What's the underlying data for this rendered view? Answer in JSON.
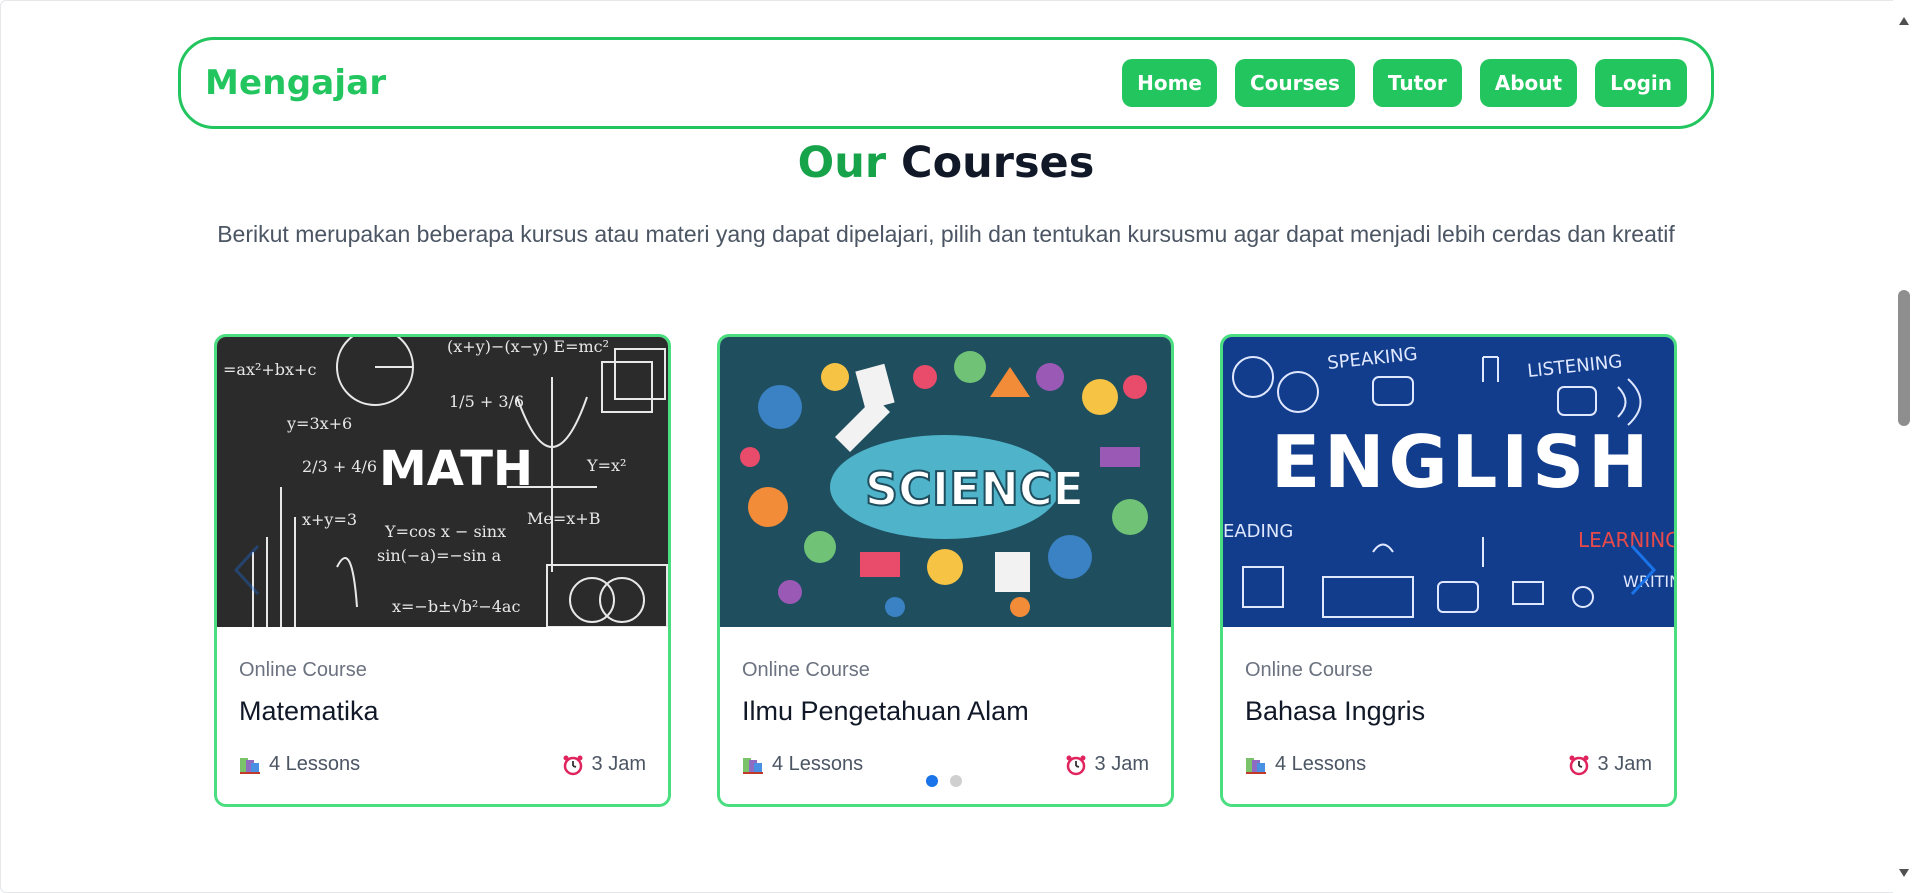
{
  "navbar": {
    "brand": "Mengajar",
    "links": [
      "Home",
      "Courses",
      "Tutor",
      "About",
      "Login"
    ]
  },
  "section": {
    "title_accent": "Our",
    "title_rest": "Courses",
    "description": "Berikut merupakan beberapa kursus atau materi yang dapat dipelajari, pilih dan tentukan kursusmu agar dapat menjadi lebih cerdas dan kreatif"
  },
  "courses": [
    {
      "kicker": "Online Course",
      "title": "Matematika",
      "lessons": "4 Lessons",
      "duration": "3 Jam",
      "image_icon": "math-chalkboard-image",
      "image_text": "MATH"
    },
    {
      "kicker": "Online Course",
      "title": "Ilmu Pengetahuan Alam",
      "lessons": "4 Lessons",
      "duration": "3 Jam",
      "image_icon": "science-doodle-image",
      "image_text": "SCIENCE"
    },
    {
      "kicker": "Online Course",
      "title": "Bahasa Inggris",
      "lessons": "4 Lessons",
      "duration": "3 Jam",
      "image_icon": "english-doodle-image",
      "image_text": "ENGLISH"
    }
  ],
  "carousel": {
    "page_count": 2,
    "active_page": 1
  },
  "colors": {
    "primary_green": "#22c55e",
    "title_green": "#16a34a",
    "card_border": "#4ade80",
    "dot_active": "#1a73e8",
    "dot_inactive": "#cfcfcf",
    "arrow_blue": "#1a73e8"
  }
}
